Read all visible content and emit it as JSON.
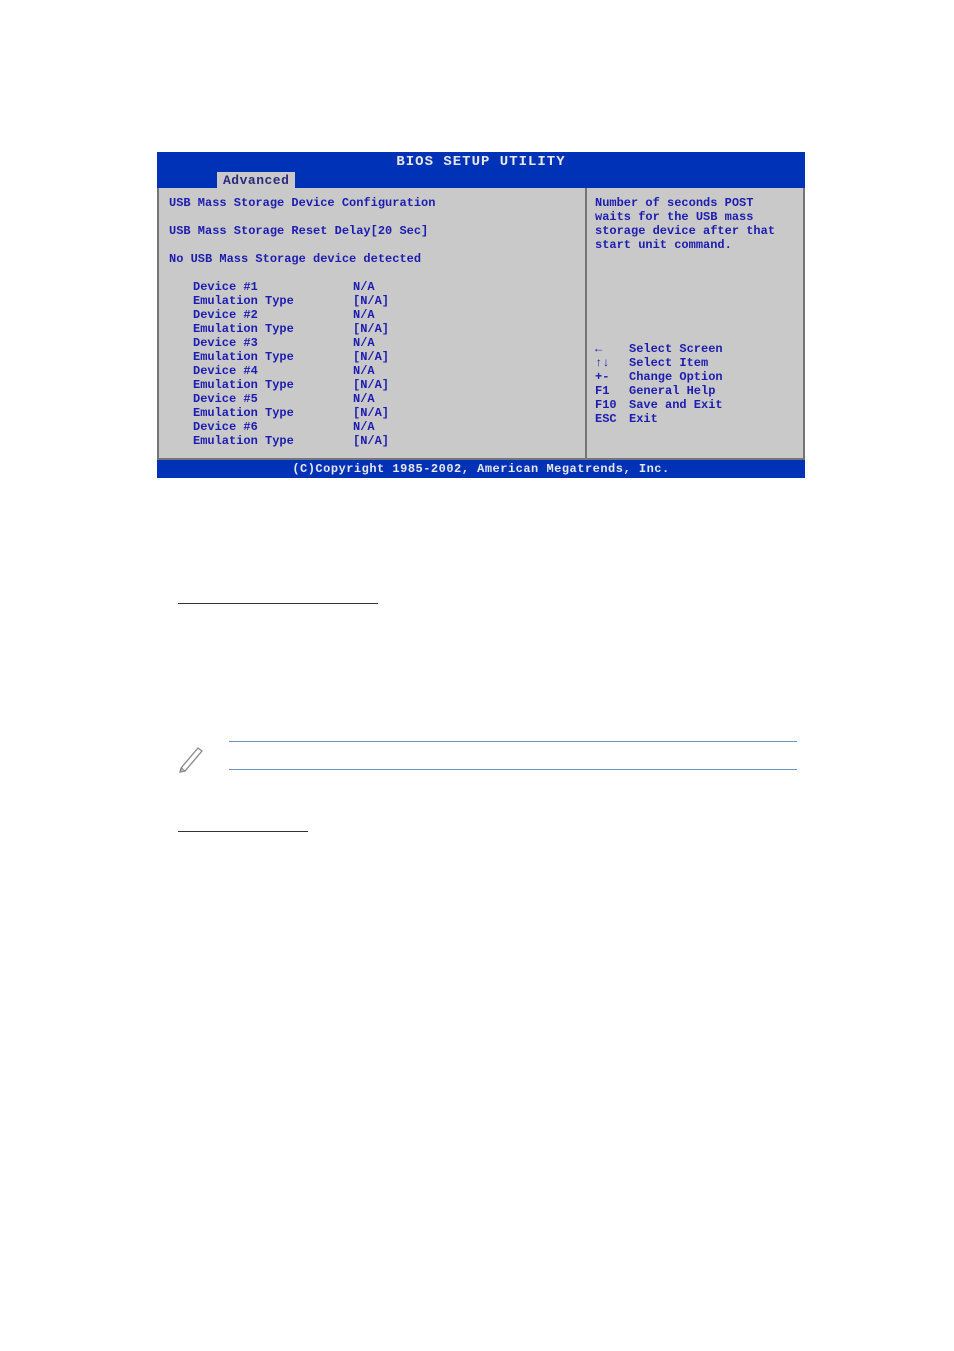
{
  "bios": {
    "title": "BIOS SETUP UTILITY",
    "tab": "Advanced",
    "left": {
      "heading": "USB Mass Storage Device Configuration",
      "reset_delay_label": "USB Mass Storage Reset Delay",
      "reset_delay_value": "[20 Sec]",
      "no_device": "No USB Mass Storage device detected",
      "devices": [
        {
          "name": "Device #1",
          "name_val": "N/A",
          "emu_label": "Emulation Type",
          "emu_val": "[N/A]"
        },
        {
          "name": "Device #2",
          "name_val": "N/A",
          "emu_label": "Emulation Type",
          "emu_val": "[N/A]"
        },
        {
          "name": "Device #3",
          "name_val": "N/A",
          "emu_label": "Emulation Type",
          "emu_val": "[N/A]"
        },
        {
          "name": "Device #4",
          "name_val": "N/A",
          "emu_label": "Emulation Type",
          "emu_val": "[N/A]"
        },
        {
          "name": "Device #5",
          "name_val": "N/A",
          "emu_label": "Emulation Type",
          "emu_val": "[N/A]"
        },
        {
          "name": "Device #6",
          "name_val": "N/A",
          "emu_label": "Emulation Type",
          "emu_val": "[N/A]"
        }
      ]
    },
    "right": {
      "help_text": "Number of seconds POST waits for the USB mass storage device after that start unit command.",
      "keys": [
        {
          "k": "←",
          "d": "Select Screen"
        },
        {
          "k": "↑↓",
          "d": "Select Item"
        },
        {
          "k": "+-",
          "d": "Change Option"
        },
        {
          "k": "F1",
          "d": "General Help"
        },
        {
          "k": "F10",
          "d": "Save and Exit"
        },
        {
          "k": "ESC",
          "d": "Exit"
        }
      ]
    },
    "footer": "(C)Copyright 1985-2002, American Megatrends, Inc."
  }
}
